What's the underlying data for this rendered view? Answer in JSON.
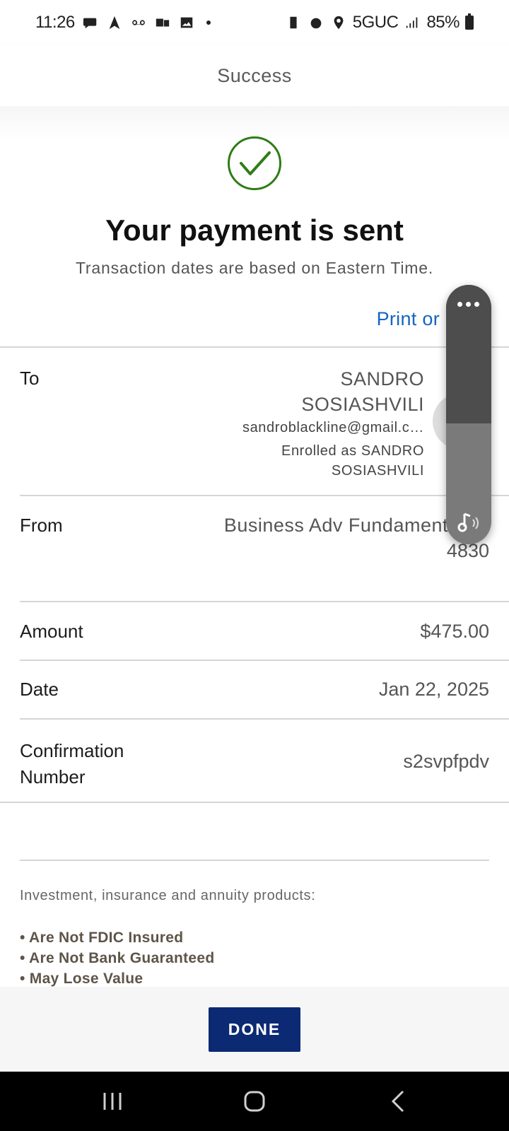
{
  "status_bar": {
    "time": "11:26",
    "network": "5GUC",
    "battery": "85%"
  },
  "header": {
    "title": "Success"
  },
  "hero": {
    "title": "Your payment is sent",
    "subtitle": "Transaction dates are based on Eastern Time.",
    "print_link": "Print or"
  },
  "details": {
    "to": {
      "label": "To",
      "name_line1": "SANDRO",
      "name_line2": "SOSIASHVILI",
      "email": "sandroblackline@gmail.c…",
      "enrolled_line1": "Enrolled as SANDRO",
      "enrolled_line2": "SOSIASHVILI"
    },
    "from": {
      "label": "From",
      "account": "Business Adv Fundament",
      "account_suffix": "4830"
    },
    "amount": {
      "label": "Amount",
      "value": "$475.00"
    },
    "date": {
      "label": "Date",
      "value": "Jan 22, 2025"
    },
    "confirmation": {
      "label_line1": "Confirmation",
      "label_line2": "Number",
      "value": "s2svpfpdv"
    }
  },
  "disclaimer": {
    "heading": "Investment, insurance and annuity products:",
    "items": [
      "• Are Not FDIC Insured",
      "• Are Not Bank Guaranteed",
      "• May Lose Value"
    ]
  },
  "done_button": "DONE",
  "colors": {
    "link": "#1565c0",
    "done_button": "#0b2a73",
    "success_check": "#2e7d16"
  }
}
